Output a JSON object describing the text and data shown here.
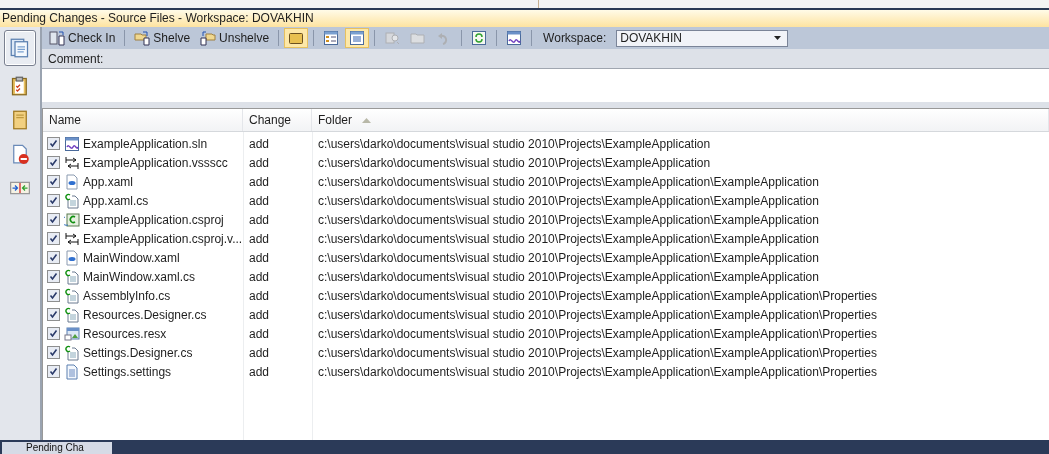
{
  "window": {
    "title": "Pending Changes - Source Files - Workspace: DOVAKHIN"
  },
  "sidebar": {
    "items": [
      {
        "kind": "files",
        "selected": true
      },
      {
        "kind": "workitems",
        "selected": false
      },
      {
        "kind": "notes",
        "selected": false
      },
      {
        "kind": "policy",
        "selected": false
      },
      {
        "kind": "conflicts",
        "selected": false
      }
    ]
  },
  "toolbar": {
    "items": [
      {
        "kind": "button",
        "label": "Check In"
      },
      {
        "kind": "separator"
      },
      {
        "kind": "button",
        "label": "Shelve"
      },
      {
        "kind": "button",
        "label": "Unshelve"
      },
      {
        "kind": "separator"
      },
      {
        "kind": "toggle",
        "selected": true
      },
      {
        "kind": "separator"
      },
      {
        "kind": "toggle",
        "selected": false
      },
      {
        "kind": "toggle",
        "selected": true
      },
      {
        "kind": "separator"
      },
      {
        "kind": "disabled"
      },
      {
        "kind": "disabled"
      },
      {
        "kind": "disabled"
      },
      {
        "kind": "separator"
      },
      {
        "kind": "button"
      },
      {
        "kind": "separator"
      },
      {
        "kind": "button"
      },
      {
        "kind": "separator"
      }
    ],
    "workspace_label": "Workspace:",
    "workspace_value": "DOVAKHIN"
  },
  "comment": {
    "label": "Comment:"
  },
  "table": {
    "columns": [
      {
        "label": "Name",
        "sorted": false
      },
      {
        "label": "Change",
        "sorted": false
      },
      {
        "label": "Folder",
        "sorted": true
      }
    ],
    "rows": [
      {
        "checked": true,
        "kind": "sln",
        "name": "ExampleApplication.sln",
        "change": "add",
        "folder": "c:\\users\\darko\\documents\\visual studio 2010\\Projects\\ExampleApplication"
      },
      {
        "checked": true,
        "kind": "vssscc",
        "name": "ExampleApplication.vssscc",
        "change": "add",
        "folder": "c:\\users\\darko\\documents\\visual studio 2010\\Projects\\ExampleApplication"
      },
      {
        "checked": true,
        "kind": "xaml",
        "name": "App.xaml",
        "change": "add",
        "folder": "c:\\users\\darko\\documents\\visual studio 2010\\Projects\\ExampleApplication\\ExampleApplication"
      },
      {
        "checked": true,
        "kind": "cs",
        "name": "App.xaml.cs",
        "change": "add",
        "folder": "c:\\users\\darko\\documents\\visual studio 2010\\Projects\\ExampleApplication\\ExampleApplication"
      },
      {
        "checked": true,
        "kind": "csproj",
        "name": "ExampleApplication.csproj",
        "change": "add",
        "folder": "c:\\users\\darko\\documents\\visual studio 2010\\Projects\\ExampleApplication\\ExampleApplication"
      },
      {
        "checked": true,
        "kind": "vssscc",
        "name": "ExampleApplication.csproj.v...",
        "change": "add",
        "folder": "c:\\users\\darko\\documents\\visual studio 2010\\Projects\\ExampleApplication\\ExampleApplication"
      },
      {
        "checked": true,
        "kind": "xaml",
        "name": "MainWindow.xaml",
        "change": "add",
        "folder": "c:\\users\\darko\\documents\\visual studio 2010\\Projects\\ExampleApplication\\ExampleApplication"
      },
      {
        "checked": true,
        "kind": "cs",
        "name": "MainWindow.xaml.cs",
        "change": "add",
        "folder": "c:\\users\\darko\\documents\\visual studio 2010\\Projects\\ExampleApplication\\ExampleApplication"
      },
      {
        "checked": true,
        "kind": "cs",
        "name": "AssemblyInfo.cs",
        "change": "add",
        "folder": "c:\\users\\darko\\documents\\visual studio 2010\\Projects\\ExampleApplication\\ExampleApplication\\Properties"
      },
      {
        "checked": true,
        "kind": "cs",
        "name": "Resources.Designer.cs",
        "change": "add",
        "folder": "c:\\users\\darko\\documents\\visual studio 2010\\Projects\\ExampleApplication\\ExampleApplication\\Properties"
      },
      {
        "checked": true,
        "kind": "resx",
        "name": "Resources.resx",
        "change": "add",
        "folder": "c:\\users\\darko\\documents\\visual studio 2010\\Projects\\ExampleApplication\\ExampleApplication\\Properties"
      },
      {
        "checked": true,
        "kind": "cs",
        "name": "Settings.Designer.cs",
        "change": "add",
        "folder": "c:\\users\\darko\\documents\\visual studio 2010\\Projects\\ExampleApplication\\ExampleApplication\\Properties"
      },
      {
        "checked": true,
        "kind": "settings",
        "name": "Settings.settings",
        "change": "add",
        "folder": "c:\\users\\darko\\documents\\visual studio 2010\\Projects\\ExampleApplication\\ExampleApplication\\Properties"
      }
    ]
  },
  "taskbar": {
    "tab": "Pending Cha"
  }
}
